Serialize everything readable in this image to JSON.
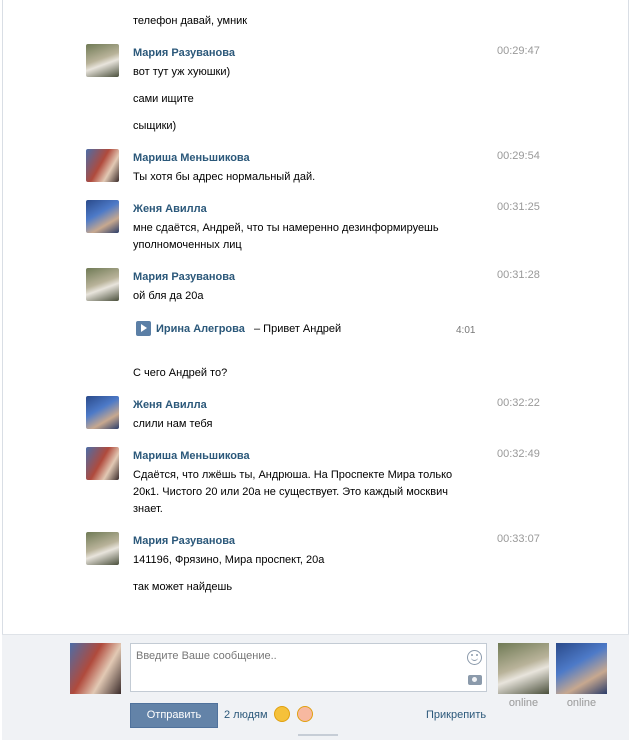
{
  "messages": [
    {
      "text": "телефон давай, умник"
    },
    {
      "author": "Мария Разуванова",
      "time": "00:29:47",
      "lines": [
        "вот тут уж хуюшки)",
        "сами ищите",
        "сыщики)"
      ]
    },
    {
      "author": "Мариша Меньшикова",
      "time": "00:29:54",
      "text": "Ты хотя бы адрес нормальный дай."
    },
    {
      "author": "Женя Авилла",
      "time": "00:31:25",
      "text": "мне сдаётся, Андрей, что ты намеренно дезинформируешь уполномоченных лиц"
    },
    {
      "author": "Мария Разуванова",
      "time": "00:31:28",
      "text": "ой бля да 20а"
    },
    {
      "text": "С чего Андрей то?"
    },
    {
      "author": "Женя Авилла",
      "time": "00:32:22",
      "text": "слили нам тебя"
    },
    {
      "author": "Мариша Меньшикова",
      "time": "00:32:49",
      "text": "Сдаётся, что лжёшь ты, Андрюша. На Проспекте Мира только 20к1. Чистого 20 или 20а не существует. Это каждый москвич знает."
    },
    {
      "author": "Мария Разуванова",
      "time": "00:33:07",
      "lines": [
        "141196, Фрязино, Мира проспект, 20а",
        "так может найдешь"
      ]
    }
  ],
  "audio": {
    "artist": "Ирина Алегрова",
    "title": "– Привет Андрей",
    "duration": "4:01"
  },
  "composer": {
    "placeholder": "Введите Ваше сообщение..",
    "send_label": "Отправить",
    "people_label": "2 людям",
    "attach_label": "Прикрепить",
    "participants": [
      {
        "status": "online"
      },
      {
        "status": "online"
      }
    ]
  },
  "colors": {
    "link": "#2b587a",
    "button": "#6383a8",
    "background": "#f0f2f5"
  }
}
